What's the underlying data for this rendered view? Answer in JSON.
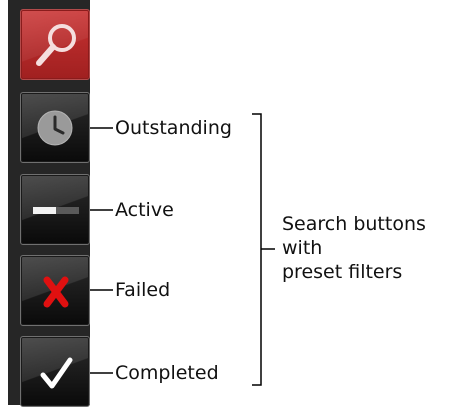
{
  "toolbar": {
    "buttons": [
      {
        "name": "search",
        "icon": "magnifier-icon",
        "active": true
      },
      {
        "name": "outstanding",
        "icon": "clock-icon",
        "label": "Outstanding"
      },
      {
        "name": "active",
        "icon": "progress-bar-icon",
        "label": "Active"
      },
      {
        "name": "failed",
        "icon": "red-x-icon",
        "label": "Failed"
      },
      {
        "name": "completed",
        "icon": "checkmark-icon",
        "label": "Completed"
      }
    ]
  },
  "callout": {
    "line1": "Search buttons",
    "line2": "with",
    "line3": "preset filters"
  },
  "colors": {
    "toolbar_bg": "#262626",
    "search_button": "#c12c2c",
    "failed_x": "#e01010"
  }
}
